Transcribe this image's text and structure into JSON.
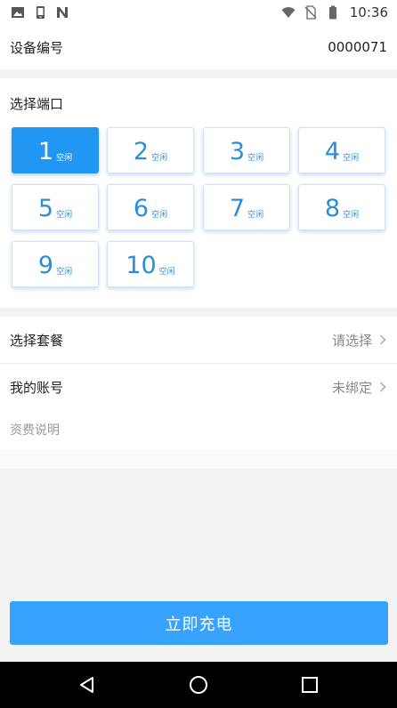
{
  "status_bar": {
    "time": "10:36",
    "left_icons": [
      "image-icon",
      "phone-icon",
      "n-icon"
    ],
    "right_icons": [
      "wifi-icon",
      "no-sim-icon",
      "battery-icon"
    ]
  },
  "device": {
    "label": "设备编号",
    "value": "0000071"
  },
  "ports": {
    "title": "选择端口",
    "selected": "1",
    "items": [
      {
        "number": "1",
        "status": "空闲"
      },
      {
        "number": "2",
        "status": "空闲"
      },
      {
        "number": "3",
        "status": "空闲"
      },
      {
        "number": "4",
        "status": "空闲"
      },
      {
        "number": "5",
        "status": "空闲"
      },
      {
        "number": "6",
        "status": "空闲"
      },
      {
        "number": "7",
        "status": "空闲"
      },
      {
        "number": "8",
        "status": "空闲"
      },
      {
        "number": "9",
        "status": "空闲"
      },
      {
        "number": "10",
        "status": "空闲"
      }
    ]
  },
  "package": {
    "label": "选择套餐",
    "value": "请选择"
  },
  "account": {
    "label": "我的账号",
    "value": "未绑定"
  },
  "tariff": {
    "label": "资费说明"
  },
  "charge_button": {
    "label": "立即充电"
  },
  "colors": {
    "accent": "#2196f3",
    "button": "#37a3ff",
    "port_text": "#2a8fd8"
  }
}
